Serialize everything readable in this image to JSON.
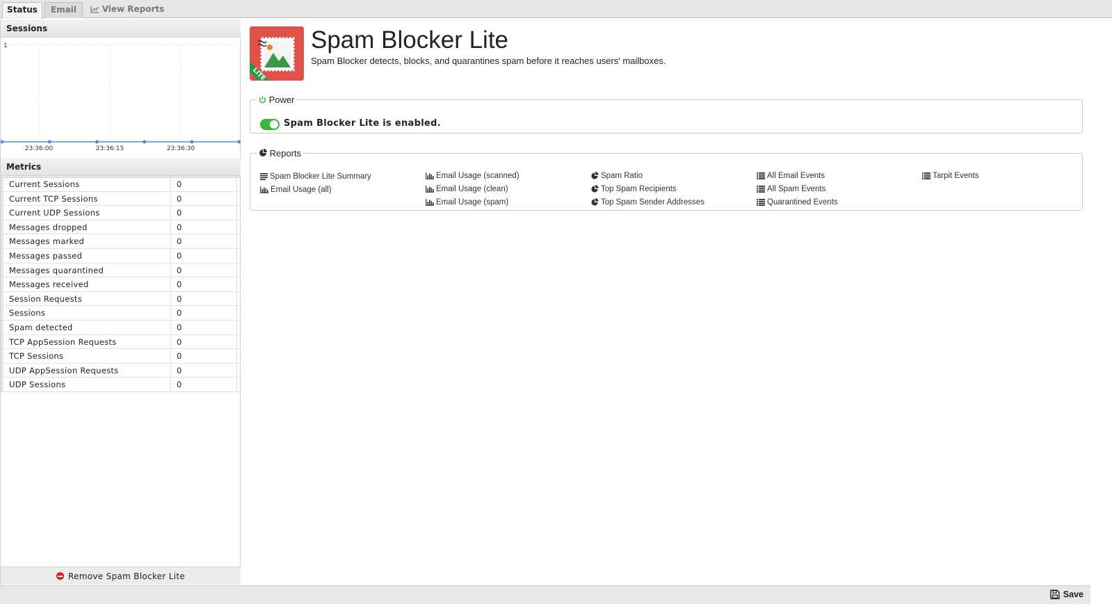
{
  "tabs": [
    {
      "label": "Status"
    },
    {
      "label": "Email"
    },
    {
      "label": "View Reports"
    }
  ],
  "sessions_panel": {
    "title": "Sessions"
  },
  "chart_data": {
    "type": "line",
    "title": "Sessions",
    "xlabel": "",
    "ylabel": "",
    "y_tick_labels": [
      "1"
    ],
    "x_tick_labels": [
      "23:36:00",
      "23:36:15",
      "23:36:30"
    ],
    "series": [
      {
        "values": [
          0,
          0,
          0,
          0,
          0,
          0
        ]
      }
    ],
    "ylim": [
      0,
      1
    ],
    "grid": true,
    "colors": {
      "line": "#4a90d9"
    }
  },
  "metrics_panel": {
    "title": "Metrics",
    "rows": [
      {
        "name": "Current Sessions",
        "value": "0"
      },
      {
        "name": "Current TCP Sessions",
        "value": "0"
      },
      {
        "name": "Current UDP Sessions",
        "value": "0"
      },
      {
        "name": "Messages dropped",
        "value": "0"
      },
      {
        "name": "Messages marked",
        "value": "0"
      },
      {
        "name": "Messages passed",
        "value": "0"
      },
      {
        "name": "Messages quarantined",
        "value": "0"
      },
      {
        "name": "Messages received",
        "value": "0"
      },
      {
        "name": "Session Requests",
        "value": "0"
      },
      {
        "name": "Sessions",
        "value": "0"
      },
      {
        "name": "Spam detected",
        "value": "0"
      },
      {
        "name": "TCP AppSession Requests",
        "value": "0"
      },
      {
        "name": "TCP Sessions",
        "value": "0"
      },
      {
        "name": "UDP AppSession Requests",
        "value": "0"
      },
      {
        "name": "UDP Sessions",
        "value": "0"
      }
    ]
  },
  "remove_button": {
    "label": "Remove Spam Blocker Lite",
    "icon": "remove-icon"
  },
  "app": {
    "title": "Spam Blocker Lite",
    "description": "Spam Blocker detects, blocks, and quarantines spam before it reaches users' mailboxes.",
    "icon_badge": "LITE"
  },
  "power": {
    "legend": "Power",
    "status_text": "Spam Blocker Lite is enabled.",
    "enabled": true
  },
  "reports": {
    "legend": "Reports",
    "columns": [
      [
        {
          "label": "Spam Blocker Lite Summary",
          "icon": "text-report-icon"
        },
        {
          "label": "Email Usage (all)",
          "icon": "bar-chart-icon"
        }
      ],
      [
        {
          "label": "Email Usage (scanned)",
          "icon": "bar-chart-icon"
        },
        {
          "label": "Email Usage (clean)",
          "icon": "bar-chart-icon"
        },
        {
          "label": "Email Usage (spam)",
          "icon": "bar-chart-icon"
        }
      ],
      [
        {
          "label": "Spam Ratio",
          "icon": "pie-chart-icon"
        },
        {
          "label": "Top Spam Recipients",
          "icon": "pie-chart-icon"
        },
        {
          "label": "Top Spam Sender Addresses",
          "icon": "pie-chart-icon"
        }
      ],
      [
        {
          "label": "All Email Events",
          "icon": "list-icon"
        },
        {
          "label": "All Spam Events",
          "icon": "list-icon"
        },
        {
          "label": "Quarantined Events",
          "icon": "list-icon"
        }
      ],
      [
        {
          "label": "Tarpit Events",
          "icon": "list-icon"
        }
      ]
    ]
  },
  "save_button": {
    "label": "Save"
  }
}
